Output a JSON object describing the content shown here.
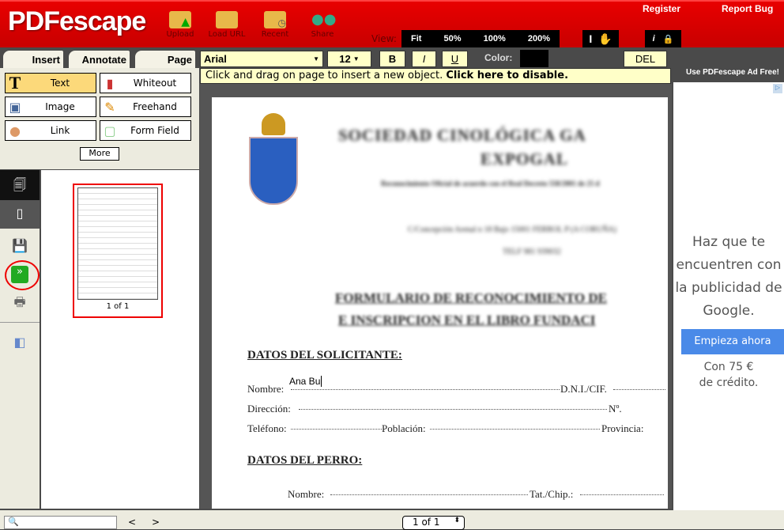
{
  "header": {
    "logo": "PDFescape",
    "buttons": [
      "Upload",
      "Load URL",
      "Recent",
      "Share"
    ],
    "register": "Register",
    "report_bug": "Report Bug",
    "view_label": "View:",
    "view_options": [
      "Fit",
      "50%",
      "100%",
      "200%"
    ],
    "cursor_tools": [
      "text-cursor-icon",
      "hand-icon"
    ],
    "info_tools": [
      "info-icon",
      "lock-icon"
    ]
  },
  "tabs": [
    "Insert",
    "Annotate",
    "Page"
  ],
  "format": {
    "font": "Arial",
    "size": "12",
    "bold": "B",
    "italic": "I",
    "underline": "U",
    "color_label": "Color:",
    "color": "#000000",
    "delete": "DEL"
  },
  "tools": [
    {
      "label": "Text",
      "icon": "text-icon",
      "active": true
    },
    {
      "label": "Whiteout",
      "icon": "whiteout-icon"
    },
    {
      "label": "Image",
      "icon": "image-icon"
    },
    {
      "label": "Freehand",
      "icon": "pencil-icon"
    },
    {
      "label": "Link",
      "icon": "link-icon"
    },
    {
      "label": "Form Field",
      "icon": "form-field-icon"
    }
  ],
  "more": "More",
  "info": {
    "text": "Click and drag on page to insert a new object. ",
    "link": "Click here to disable."
  },
  "thumbnail": {
    "label": "1 of 1"
  },
  "document": {
    "title1": "SOCIEDAD CINOLÓGICA GA",
    "title2": "EXPOGAL",
    "subtitle": "Reconocimiento Oficial de acuerdo con el Real Decreto 558/2001 de 25 d",
    "address": "C/Concepción Arenal  n  18 Bajo 15001 FERROL P (A CORUÑA)",
    "phone": "TELF 981 939032",
    "form1": "FORMULARIO DE RECONOCIMIENTO DE",
    "form2": "E INSCRIPCION EN EL LIBRO FUNDACI",
    "sec1": "DATOS DEL SOLICITANTE:",
    "nombre": "Nombre:",
    "dni": "D.N.I./CIF.",
    "direccion": "Dirección:",
    "numero": "Nº.",
    "telefono": "Teléfono:",
    "poblacion": "Población:",
    "provincia": "Provincia:",
    "sec2": "DATOS DEL PERRO:",
    "nombre2": "Nombre:",
    "chip": "Tat./Chip.:",
    "typed": "Ana Bu"
  },
  "ad": {
    "header": "Use PDFescape Ad Free!",
    "text": "Haz que te encuentren con la publicidad de Google.",
    "button": "Empieza ahora",
    "offer1": "Con 75 €",
    "offer2": "de crédito."
  },
  "bottom": {
    "search_placeholder": "",
    "prev": "<",
    "next": ">",
    "page": "1 of 1"
  }
}
